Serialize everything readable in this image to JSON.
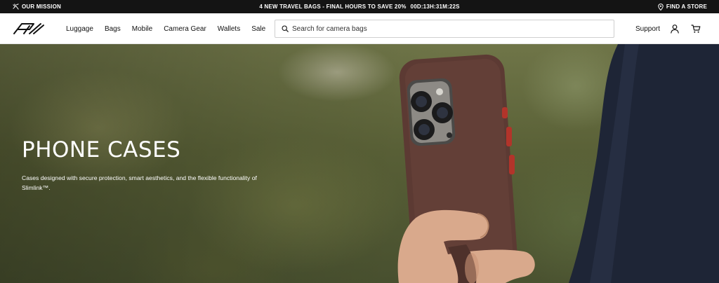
{
  "topbar": {
    "mission": "OUR MISSION",
    "promo": "4 NEW TRAVEL BAGS - FINAL HOURS TO SAVE 20%",
    "countdown": "00d:13h:31m:22s",
    "store": "FIND A STORE"
  },
  "header": {
    "nav": [
      "Luggage",
      "Bags",
      "Mobile",
      "Camera Gear",
      "Wallets",
      "Sale"
    ],
    "search_placeholder": "Search for camera bags",
    "support": "Support"
  },
  "hero": {
    "title": "PHONE CASES",
    "description": "Cases designed with secure protection, smart aesthetics, and the flexible functionality of Slimlink™."
  },
  "colors": {
    "topbar_bg": "#141414",
    "case_color": "#5c3a33",
    "button_red": "#b2342a"
  }
}
